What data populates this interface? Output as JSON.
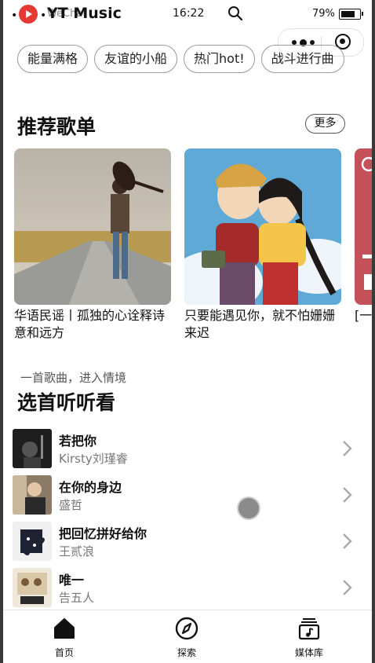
{
  "status_bar": {
    "signal_dots": "•••••",
    "carrier": "WeChat",
    "time": "16:22",
    "battery_percent": "79%",
    "battery_level": 0.79
  },
  "app": {
    "title": "YT Music",
    "brand_color": "#e53935"
  },
  "chips": [
    "能量满格",
    "友谊的小船",
    "热门hot!",
    "战斗进行曲"
  ],
  "recommend": {
    "title": "推荐歌单",
    "more_label": "更多",
    "cards": [
      {
        "text": "华语民谣丨孤独的心诠释诗意和远方"
      },
      {
        "text": "只要能遇见你，就不怕姗姗来迟"
      },
      {
        "text": "[一你"
      }
    ]
  },
  "pick": {
    "caption": "一首歌曲，进入情境",
    "title": "选首听听看",
    "songs": [
      {
        "title": "若把你",
        "artist": "Kirsty刘瑾睿"
      },
      {
        "title": "在你的身边",
        "artist": "盛哲"
      },
      {
        "title": "把回忆拼好给你",
        "artist": "王贰浪"
      },
      {
        "title": "唯一",
        "artist": "告五人"
      }
    ]
  },
  "tabbar": {
    "items": [
      {
        "label": "首页",
        "icon": "home-icon"
      },
      {
        "label": "探索",
        "icon": "compass-icon"
      },
      {
        "label": "媒体库",
        "icon": "library-icon"
      }
    ]
  }
}
